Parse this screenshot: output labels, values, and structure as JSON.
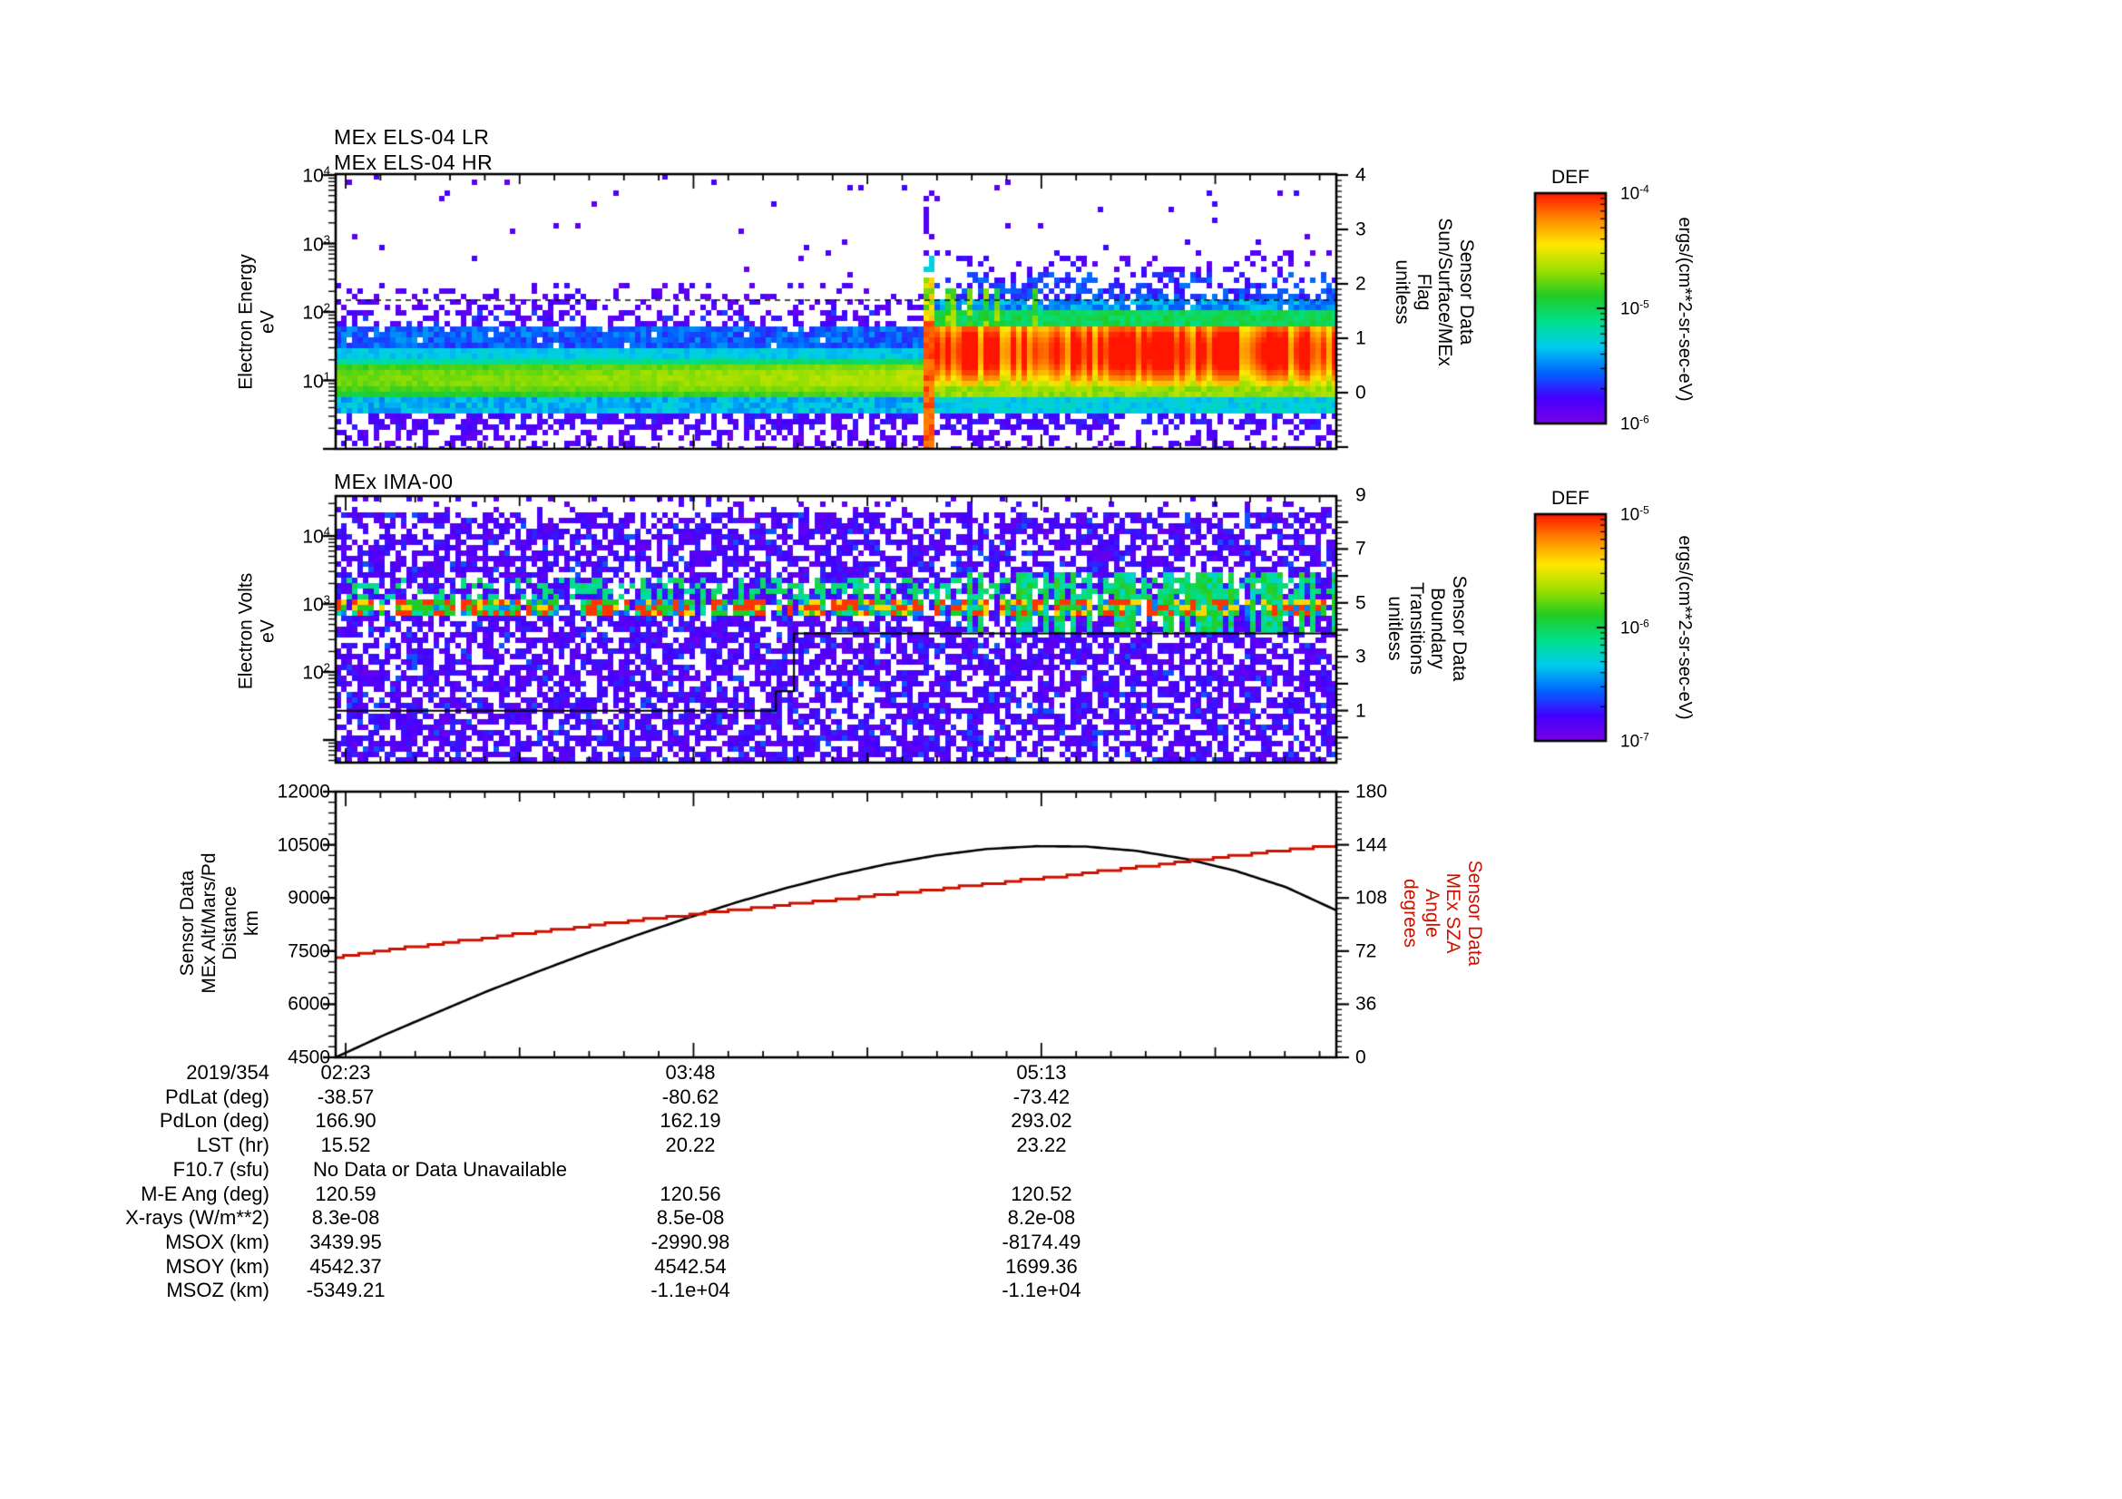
{
  "figure_titles": {
    "els_lr": "MEx ELS-04 LR",
    "els_hr": "MEx ELS-04 HR",
    "ima": "MEx IMA-00"
  },
  "axes": {
    "els_left_label": [
      "Electron Energy",
      "eV"
    ],
    "els_left_ticks": [
      "10^4",
      "10^3",
      "10^2",
      "10^1"
    ],
    "els_right_label": [
      "Sensor Data",
      "Sun/Surface/MEx",
      "Flag",
      "unitless"
    ],
    "els_right_ticks": [
      "4",
      "3",
      "2",
      "1",
      "0"
    ],
    "ima_left_label": [
      "Electron Volts",
      "eV"
    ],
    "ima_left_ticks": [
      "10^4",
      "10^3",
      "10^2"
    ],
    "ima_right_label": [
      "Sensor Data",
      "Boundary",
      "Transitions",
      "unitless"
    ],
    "ima_right_ticks": [
      "9",
      "7",
      "5",
      "3",
      "1"
    ],
    "lin_left_label": [
      "Sensor Data",
      "MEx Alt/Mars/Pd",
      "Distance",
      "km"
    ],
    "lin_left_ticks": [
      "12000",
      "10500",
      "9000",
      "7500",
      "6000",
      "4500"
    ],
    "lin_right_label": [
      "Sensor Data",
      "MEx SZA",
      "Angle",
      "degrees"
    ],
    "lin_right_ticks": [
      "180",
      "144",
      "108",
      "72",
      "36",
      "0"
    ],
    "x_date": "2019/354",
    "x_ticks": [
      {
        "label": "02:23",
        "frac": 0.01
      },
      {
        "label": "03:48",
        "frac": 0.3545
      },
      {
        "label": "05:13",
        "frac": 0.7053
      }
    ]
  },
  "colorbars": [
    {
      "title": "DEF",
      "ticks": [
        "10^-4",
        "10^-5",
        "10^-6"
      ],
      "units": "ergs/(cm**2-sr-sec-eV)"
    },
    {
      "title": "DEF",
      "ticks": [
        "10^-5",
        "10^-6",
        "10^-7"
      ],
      "units": "ergs/(cm**2-sr-sec-eV)"
    }
  ],
  "colors": {
    "accent_red": "#cc1100",
    "axis": "#000000",
    "colormap": [
      "#7a00e6",
      "#4400ff",
      "#0066ff",
      "#00ccee",
      "#00e08a",
      "#22cc22",
      "#9fe000",
      "#ffe800",
      "#ff8800",
      "#ff1500"
    ]
  },
  "chart_data": [
    {
      "id": "els",
      "type": "heatmap",
      "title": "MEx ELS-04 LR / MEx ELS-04 HR",
      "ylabel": "Electron Energy (eV)",
      "y_scale": "log",
      "y_range_eV": [
        1,
        10000
      ],
      "x_start": "02:23",
      "x_labels": [
        "02:23",
        "03:48",
        "05:13"
      ],
      "event_frac": 0.5904,
      "flag_dashed_line_value": 1.7,
      "features": {
        "core_band_eV_pre": [
          7,
          22
        ],
        "core_band_eV_post": [
          9,
          70
        ],
        "spike_top_eV": 600,
        "description": "green-yellow core band across full width, brightening to yellow toward center, turning to a red/orange enhanced band after a vertical spike event near 04:50; blue/purple speckle 30-300 eV; sparse purple dots above"
      }
    },
    {
      "id": "ima",
      "type": "heatmap",
      "title": "MEx IMA-00",
      "ylabel": "Electron Volts (eV)",
      "y_scale": "log",
      "y_range_eV": [
        4.6,
        39000
      ],
      "bright_line_eV": [
        700,
        1100
      ],
      "secondary_band_eV": [
        1600,
        2600
      ],
      "step_line_eV": [
        [
          0,
          27
        ],
        [
          0.44,
          27
        ],
        [
          0.44,
          52
        ],
        [
          0.458,
          52
        ],
        [
          0.458,
          370
        ],
        [
          1,
          370
        ]
      ],
      "features": {
        "description": "dense purple noise speckle over full panel; bright multicolored (red/yellow/green/cyan) periodic blobs near 1 keV; cyan-green vertical streaks denser after ~0.63 of time axis; black step threshold line"
      }
    },
    {
      "id": "lines",
      "type": "line",
      "x_unit": "fraction_of_time_axis",
      "series": [
        {
          "name": "MEx Alt/Mars/Pd Distance",
          "units": "km",
          "color": "#000000",
          "axis": "left",
          "ylim": [
            4500,
            12000
          ],
          "x": [
            0,
            0.05,
            0.1,
            0.15,
            0.2,
            0.25,
            0.3,
            0.35,
            0.4,
            0.45,
            0.5,
            0.55,
            0.6,
            0.65,
            0.7,
            0.75,
            0.8,
            0.85,
            0.9,
            0.95,
            1.0
          ],
          "y": [
            4500,
            5150,
            5750,
            6350,
            6900,
            7430,
            7940,
            8420,
            8870,
            9280,
            9640,
            9950,
            10200,
            10380,
            10460,
            10450,
            10330,
            10100,
            9760,
            9300,
            8650
          ]
        },
        {
          "name": "MEx SZA Angle",
          "units": "degrees",
          "color": "#cc1100",
          "axis": "right",
          "ylim": [
            0,
            180
          ],
          "stepped": true,
          "x": [
            0,
            0.1,
            0.2,
            0.3,
            0.4,
            0.5,
            0.6,
            0.7,
            0.8,
            0.9,
            1.0
          ],
          "y": [
            68,
            77,
            85,
            93,
            100,
            107,
            114,
            121,
            129,
            137,
            144
          ]
        }
      ]
    }
  ],
  "table": {
    "no_data_text": "No Data or Data Unavailable",
    "rows": [
      {
        "label": "2019/354",
        "values": [
          "02:23",
          "03:48",
          "05:13"
        ]
      },
      {
        "label": "PdLat (deg)",
        "values": [
          "-38.57",
          "-80.62",
          "-73.42"
        ]
      },
      {
        "label": "PdLon (deg)",
        "values": [
          "166.90",
          "162.19",
          "293.02"
        ]
      },
      {
        "label": "LST (hr)",
        "values": [
          "15.52",
          "20.22",
          "23.22"
        ]
      },
      {
        "label": "F10.7 (sfu)",
        "values": [],
        "special": "no_data"
      },
      {
        "label": "M-E Ang (deg)",
        "values": [
          "120.59",
          "120.56",
          "120.52"
        ]
      },
      {
        "label": "X-rays (W/m**2)",
        "values": [
          "8.3e-08",
          "8.5e-08",
          "8.2e-08"
        ]
      },
      {
        "label": "MSOX (km)",
        "values": [
          "3439.95",
          "-2990.98",
          "-8174.49"
        ]
      },
      {
        "label": "MSOY (km)",
        "values": [
          "4542.37",
          "4542.54",
          "1699.36"
        ]
      },
      {
        "label": "MSOZ (km)",
        "values": [
          "-5349.21",
          "-1.1e+04",
          "-1.1e+04"
        ]
      }
    ]
  }
}
